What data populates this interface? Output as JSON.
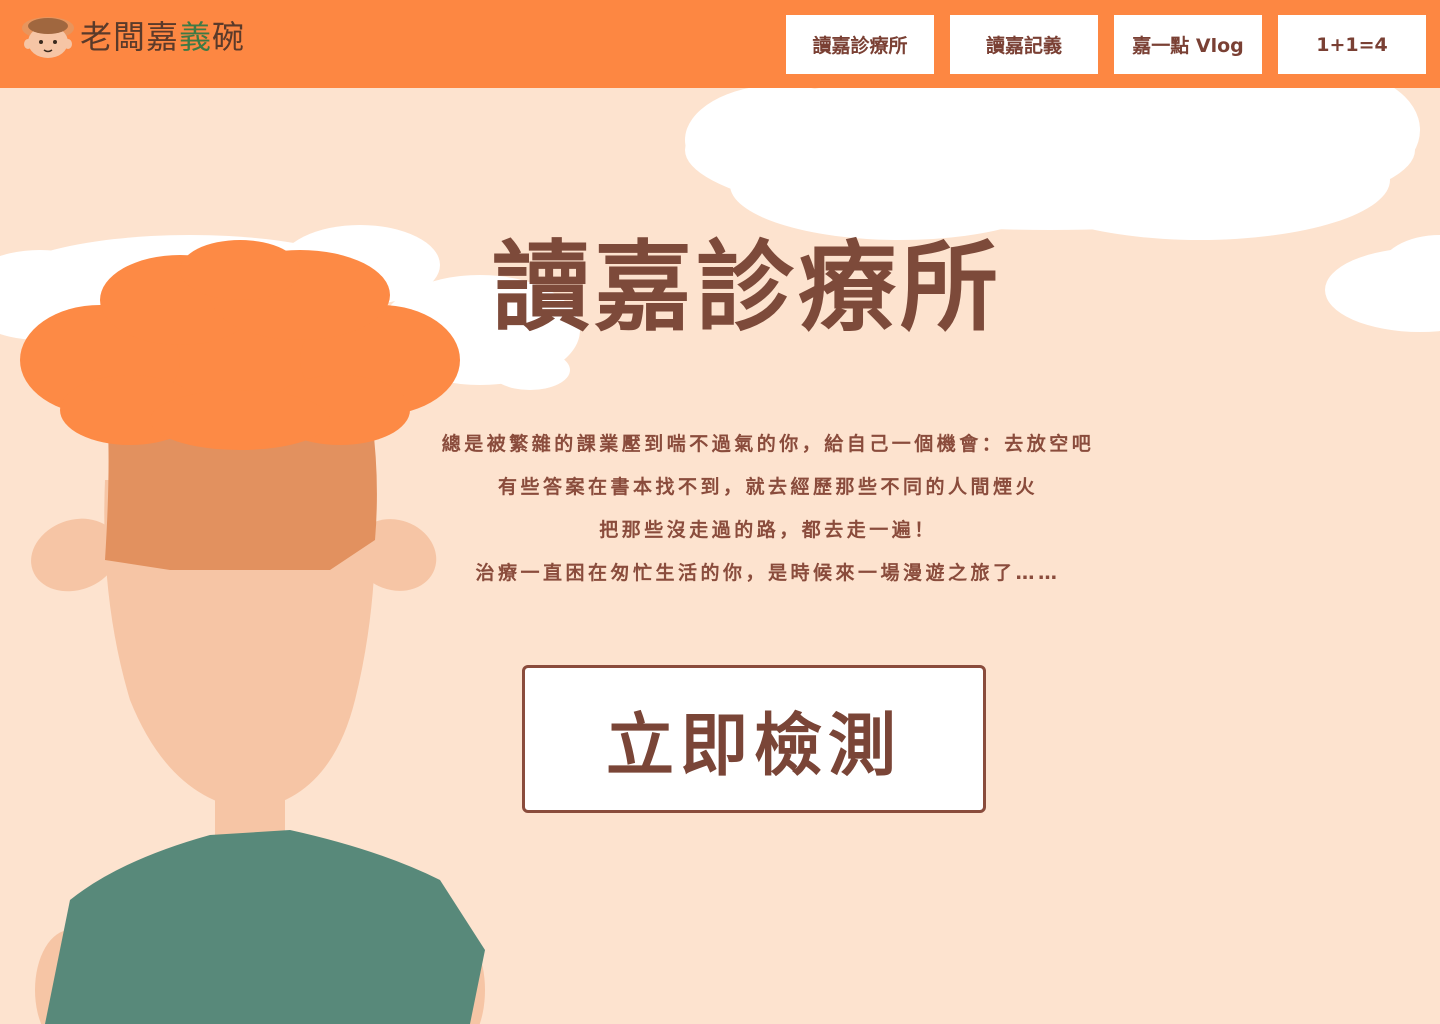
{
  "header": {
    "logo": {
      "text_part1": "老闆嘉",
      "text_part2": "義",
      "text_part3": "碗",
      "icon": "cartoon-face-logo-icon"
    },
    "nav": [
      {
        "label": "讀嘉診療所"
      },
      {
        "label": "讀嘉記義"
      },
      {
        "label": "嘉一點 Vlog"
      },
      {
        "label": "1+1=4"
      }
    ]
  },
  "hero": {
    "title": "讀嘉診療所",
    "lines": [
      "總是被繁雜的課業壓到喘不過氣的你，給自己一個機會：去放空吧",
      "有些答案在書本找不到，就去經歷那些不同的人間煙火",
      "把那些沒走過的路，都去走一遍！",
      "治療一直困在匆忙生活的你，是時候來一場漫遊之旅了……"
    ],
    "cta_label": "立即檢測"
  },
  "colors": {
    "header_bg": "#fd8742",
    "page_bg": "#fde3cf",
    "text_brown": "#7d4a3a",
    "hair_orange": "#fd8a45",
    "shirt_green": "#58897a",
    "skin": "#f6c5a5",
    "cloud": "#ffffff"
  }
}
